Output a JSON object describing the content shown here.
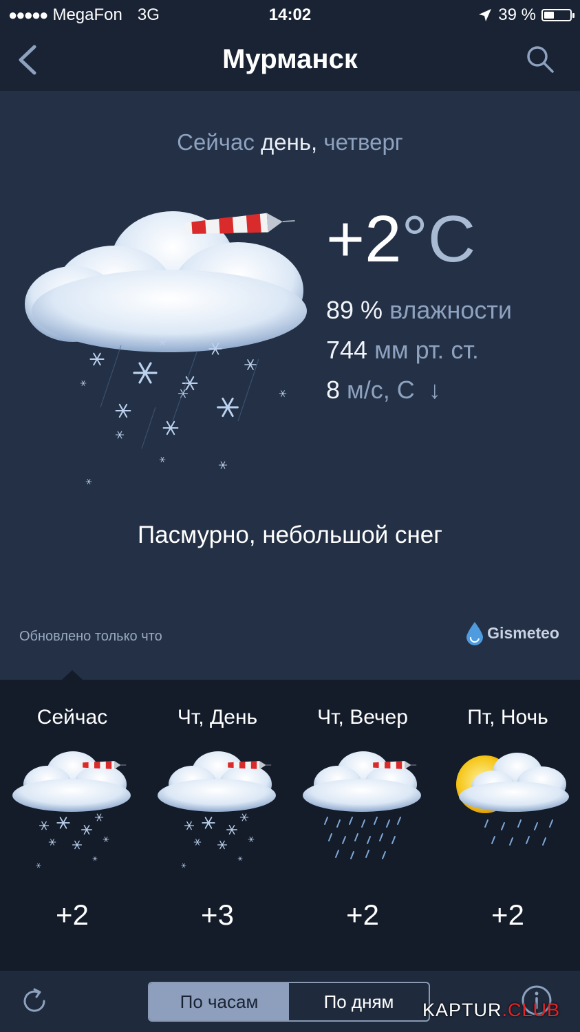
{
  "status": {
    "signal_dots": "●●●●●",
    "carrier": "MegaFon",
    "network": "3G",
    "time": "14:02",
    "battery_text": "39 %",
    "battery_level": 0.39
  },
  "nav": {
    "title": "Мурманск",
    "back_icon": "chevron-left-icon",
    "search_icon": "search-icon"
  },
  "now": {
    "prefix": "Сейчас",
    "daypart": "день,",
    "weekday": "четверг",
    "temp_value": "+2",
    "temp_unit": "°C",
    "humidity_value": "89 %",
    "humidity_label": "влажности",
    "pressure_value": "744",
    "pressure_label": "мм рт. ст.",
    "wind_value": "8",
    "wind_label": "м/с, С",
    "wind_arrow": "↓",
    "condition": "Пасмурно, небольшой снег",
    "updated": "Обновлено только что",
    "provider": "Gismeteo"
  },
  "forecast": [
    {
      "label": "Сейчас",
      "temp": "+2",
      "icon": "cloud-snow-wind-icon"
    },
    {
      "label": "Чт, День",
      "temp": "+3",
      "icon": "cloud-snow-wind-icon"
    },
    {
      "label": "Чт, Вечер",
      "temp": "+2",
      "icon": "cloud-rain-wind-icon"
    },
    {
      "label": "Пт, Ночь",
      "temp": "+2",
      "icon": "moon-cloud-rain-icon"
    }
  ],
  "bottom": {
    "refresh_icon": "refresh-icon",
    "tab_hours": "По часам",
    "tab_days": "По дням",
    "active_tab": "hours",
    "info_icon": "info-icon",
    "watermark_a": "KAPTUR",
    "watermark_b": ".CLUB"
  },
  "colors": {
    "background": "#1f2a3c",
    "forecast_bg": "#141c2a",
    "muted_text": "#8ea2bf",
    "segment_active": "#8d9fbd",
    "windsock_red": "#d92b2b",
    "sun_yellow": "#f5c518"
  }
}
